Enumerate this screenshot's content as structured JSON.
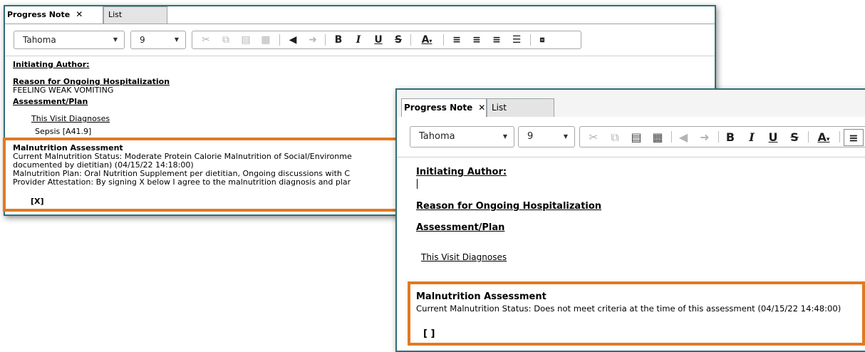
{
  "editor_toolbar": {
    "font_name": "Tahoma",
    "font_size": "9",
    "cut_icon": "scissors-icon",
    "copy_icon": "copy-icon",
    "paste_icon": "paste-icon",
    "paste_special_icon": "paste-special-icon",
    "undo_icon": "undo-icon",
    "redo_icon": "redo-icon",
    "bold_label": "B",
    "italic_label": "I",
    "underline_label": "U",
    "strike_label": "S",
    "font_color_label": "A",
    "insert_icon": "insert-field-icon"
  },
  "window_back": {
    "tab_active": "Progress Note",
    "tab_close": "✕",
    "tab_inactive": "List",
    "initiating_author": "Initiating Author:",
    "reason_heading": "Reason for Ongoing Hospitalization",
    "reason_text": "FEELING WEAK VOMITING",
    "assessment_heading": "Assessment/Plan",
    "visit_diagnoses": "This Visit Diagnoses",
    "diagnosis_item": "Sepsis [A41.9]",
    "malnutrition_heading": "Malnutrition Assessment",
    "status_line1": "Current Malnutrition Status: Moderate Protein Calorie Malnutrition of Social/Environme",
    "status_line2": "documented by dietitian) (04/15/22 14:18:00)",
    "plan_line": "Malnutrition Plan: Oral Nutrition Supplement per dietitian, Ongoing discussions with C",
    "attestation_line": "Provider Attestation: By signing X below I agree to the malnutrition diagnosis and plar",
    "checkbox_text": "[X]"
  },
  "window_front": {
    "tab_active": "Progress Note",
    "tab_close": "✕",
    "tab_inactive": "List",
    "initiating_author": "Initiating Author:",
    "reason_heading": "Reason for Ongoing Hospitalization",
    "assessment_heading": "Assessment/Plan",
    "visit_diagnoses": "This Visit Diagnoses",
    "malnutrition_heading": "Malnutrition Assessment",
    "status_line": "Current Malnutrition Status: Does not meet criteria at the time of this assessment (04/15/22 14:48:00)",
    "checkbox_text": "[ ]"
  },
  "colors": {
    "highlight_orange": "#e07a22",
    "window_border": "#2f6f7a"
  }
}
